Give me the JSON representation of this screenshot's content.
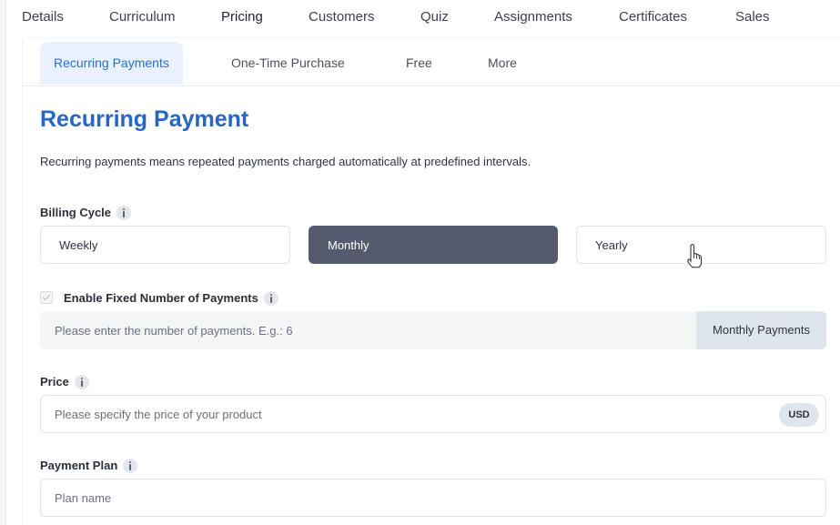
{
  "top_tabs": [
    "Details",
    "Curriculum",
    "Pricing",
    "Customers",
    "Quiz",
    "Assignments",
    "Certificates",
    "Sales"
  ],
  "sub_tabs": [
    "Recurring Payments",
    "One-Time Purchase",
    "Free",
    "More"
  ],
  "section": {
    "title": "Recurring Payment",
    "description": "Recurring payments means repeated payments charged automatically at predefined intervals."
  },
  "billing_cycle": {
    "label": "Billing Cycle",
    "options": [
      "Weekly",
      "Monthly",
      "Yearly"
    ],
    "selected": "Monthly"
  },
  "fixed_payments": {
    "label": "Enable Fixed Number of Payments",
    "checked": true,
    "placeholder": "Please enter the number of payments. E.g.: 6",
    "suffix": "Monthly Payments"
  },
  "price": {
    "label": "Price",
    "placeholder": "Please specify the price of your product",
    "currency": "USD"
  },
  "payment_plan": {
    "label": "Payment Plan",
    "placeholder": "Plan name"
  },
  "colors": {
    "accent": "#2667c4",
    "selected_button": "#555a6e",
    "active_subtab_bg": "#e8f1fc"
  }
}
